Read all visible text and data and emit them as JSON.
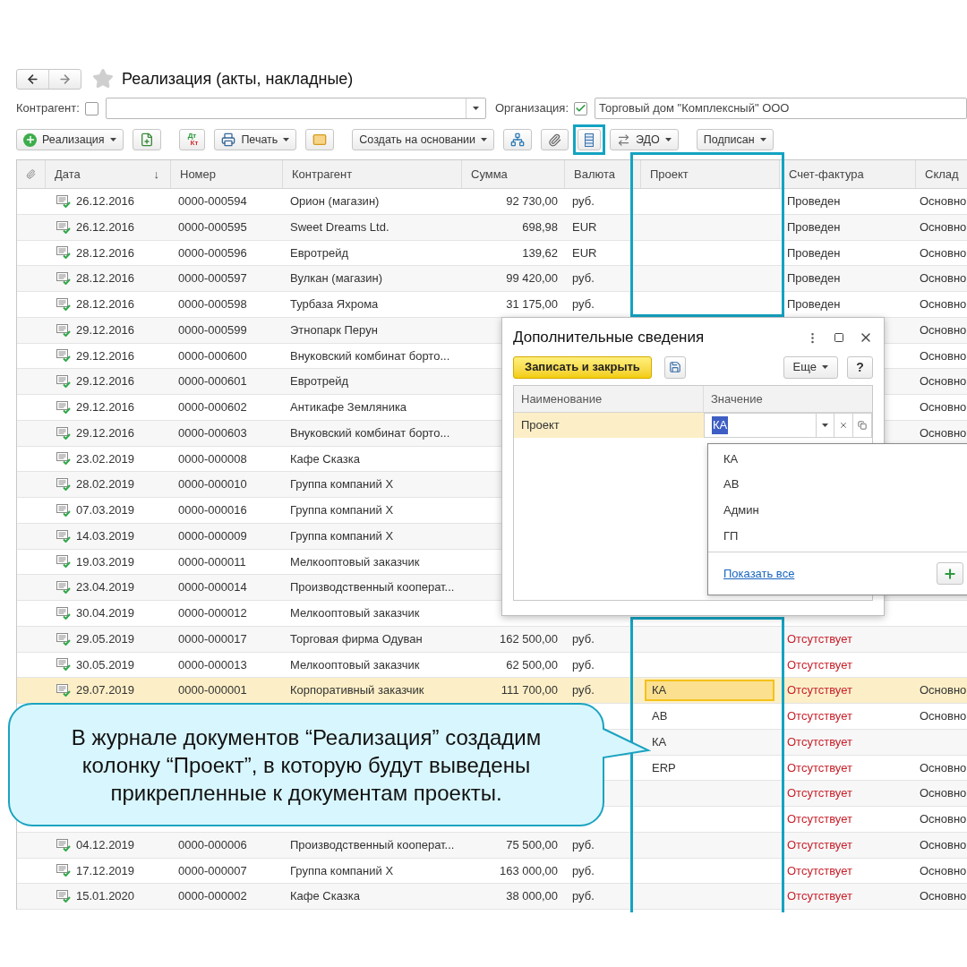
{
  "window": {
    "title": "Реализация (акты, накладные)"
  },
  "filters": [
    {
      "label": "Контрагент:",
      "checked": false,
      "kind": "combo"
    },
    {
      "label": "Организация:",
      "checked": true,
      "value": "Торговый дом \"Комплексный\" ООО",
      "kind": "text"
    }
  ],
  "toolbar": [
    [
      {
        "kind": "plus",
        "label": "Реализация",
        "dropdown": true
      },
      {
        "kind": "doc-add"
      }
    ],
    [
      {
        "kind": "dtkt",
        "icon_text": [
          "Дт",
          "Кт"
        ]
      },
      {
        "kind": "print",
        "label": "Печать",
        "dropdown": true
      },
      {
        "kind": "mail"
      }
    ],
    [
      {
        "kind": "text",
        "label": "Создать на основании",
        "dropdown": true
      },
      {
        "kind": "struct"
      },
      {
        "kind": "clip"
      },
      {
        "kind": "list",
        "highlighted": true
      },
      {
        "kind": "edo",
        "label": "ЭДО",
        "dropdown": true
      }
    ],
    [
      {
        "kind": "text",
        "label": "Подписан",
        "dropdown": true
      }
    ]
  ],
  "table": {
    "columns": [
      {
        "kind": "clip"
      },
      {
        "label": "Дата",
        "sort": "↓"
      },
      {
        "label": "Номер"
      },
      {
        "label": "Контрагент"
      },
      {
        "label": "Сумма"
      },
      {
        "label": "Валюта"
      },
      {
        "label": "Проект",
        "highlighted": true
      },
      {
        "label": "Счет-фактура"
      },
      {
        "label": "Склад"
      }
    ],
    "rows": [
      {
        "date": "26.12.2016",
        "number": "0000-000594",
        "counterparty": "Орион (магазин)",
        "sum": "92 730,00",
        "currency": "руб.",
        "invoice": "Проведен",
        "invoice_missing": false,
        "warehouse": "Основно",
        "selected": false
      },
      {
        "date": "26.12.2016",
        "number": "0000-000595",
        "counterparty": "Sweet Dreams Ltd.",
        "sum": "698,98",
        "currency": "EUR",
        "invoice": "Проведен",
        "invoice_missing": false,
        "warehouse": "Основно",
        "selected": false
      },
      {
        "date": "28.12.2016",
        "number": "0000-000596",
        "counterparty": "Евротрейд",
        "sum": "139,62",
        "currency": "EUR",
        "invoice": "Проведен",
        "invoice_missing": false,
        "warehouse": "Основно",
        "selected": false
      },
      {
        "date": "28.12.2016",
        "number": "0000-000597",
        "counterparty": "Вулкан (магазин)",
        "sum": "99 420,00",
        "currency": "руб.",
        "invoice": "Проведен",
        "invoice_missing": false,
        "warehouse": "Основно",
        "selected": false
      },
      {
        "date": "28.12.2016",
        "number": "0000-000598",
        "counterparty": "Турбаза Яхрома",
        "sum": "31 175,00",
        "currency": "руб.",
        "invoice": "Проведен",
        "invoice_missing": false,
        "warehouse": "Основно",
        "selected": false
      },
      {
        "date": "29.12.2016",
        "number": "0000-000599",
        "counterparty": "Этнопарк Перун",
        "warehouse": "Основно",
        "selected": false
      },
      {
        "date": "29.12.2016",
        "number": "0000-000600",
        "counterparty": "Внуковский комбинат борто...",
        "warehouse": "Основно",
        "selected": false
      },
      {
        "date": "29.12.2016",
        "number": "0000-000601",
        "counterparty": "Евротрейд",
        "warehouse": "Основно",
        "selected": false
      },
      {
        "date": "29.12.2016",
        "number": "0000-000602",
        "counterparty": "Антикафе Земляника",
        "warehouse": "Основно",
        "selected": false
      },
      {
        "date": "29.12.2016",
        "number": "0000-000603",
        "counterparty": "Внуковский комбинат борто...",
        "warehouse": "Основно",
        "selected": false
      },
      {
        "date": "23.02.2019",
        "number": "0000-000008",
        "counterparty": "Кафе Сказка",
        "selected": false
      },
      {
        "date": "28.02.2019",
        "number": "0000-000010",
        "counterparty": "Группа компаний X",
        "selected": false
      },
      {
        "date": "07.03.2019",
        "number": "0000-000016",
        "counterparty": "Группа компаний X",
        "selected": false
      },
      {
        "date": "14.03.2019",
        "number": "0000-000009",
        "counterparty": "Группа компаний X",
        "selected": false
      },
      {
        "date": "19.03.2019",
        "number": "0000-000011",
        "counterparty": "Мелкооптовый заказчик",
        "selected": false
      },
      {
        "date": "23.04.2019",
        "number": "0000-000014",
        "counterparty": "Производственный кооперат...",
        "selected": false
      },
      {
        "date": "30.04.2019",
        "number": "0000-000012",
        "counterparty": "Мелкооптовый заказчик",
        "selected": false
      },
      {
        "date": "29.05.2019",
        "number": "0000-000017",
        "counterparty": "Торговая фирма Одуван",
        "sum": "162 500,00",
        "currency": "руб.",
        "invoice": "Отсутствует",
        "invoice_missing": true,
        "selected": false
      },
      {
        "date": "30.05.2019",
        "number": "0000-000013",
        "counterparty": "Мелкооптовый заказчик",
        "sum": "62 500,00",
        "currency": "руб.",
        "invoice": "Отсутствует",
        "invoice_missing": true,
        "selected": false
      },
      {
        "date": "29.07.2019",
        "number": "0000-000001",
        "counterparty": "Корпоративный заказчик",
        "sum": "111 700,00",
        "currency": "руб.",
        "project": "КА",
        "invoice": "Отсутствует",
        "invoice_missing": true,
        "warehouse": "Основно",
        "selected": true
      },
      {
        "project": "АВ",
        "invoice": "Отсутствует",
        "invoice_missing": true,
        "warehouse": "Основно",
        "selected": false
      },
      {
        "project": "КА",
        "invoice": "Отсутствует",
        "invoice_missing": true,
        "selected": false
      },
      {
        "project": "ERP",
        "invoice": "Отсутствует",
        "invoice_missing": true,
        "warehouse": "Основно",
        "selected": false
      },
      {
        "invoice": "Отсутствует",
        "invoice_missing": true,
        "warehouse": "Основно",
        "selected": false
      },
      {
        "invoice": "Отсутствует",
        "invoice_missing": true,
        "warehouse": "Основно",
        "selected": false
      },
      {
        "date": "04.12.2019",
        "number": "0000-000006",
        "counterparty": "Производственный кооперат...",
        "sum": "75 500,00",
        "currency": "руб.",
        "invoice": "Отсутствует",
        "invoice_missing": true,
        "warehouse": "Основно",
        "selected": false
      },
      {
        "date": "17.12.2019",
        "number": "0000-000007",
        "counterparty": "Группа компаний X",
        "sum": "163 000,00",
        "currency": "руб.",
        "invoice": "Отсутствует",
        "invoice_missing": true,
        "warehouse": "Основно",
        "selected": false
      },
      {
        "date": "15.01.2020",
        "number": "0000-000002",
        "counterparty": "Кафе Сказка",
        "sum": "38 000,00",
        "currency": "руб.",
        "invoice": "Отсутствует",
        "invoice_missing": true,
        "warehouse": "Основно",
        "selected": false
      }
    ]
  },
  "dialog": {
    "title": "Дополнительные сведения",
    "primary_button": "Записать и закрыть",
    "more_button": "Еще",
    "help_button": "?",
    "columns": [
      "Наименование",
      "Значение"
    ],
    "rows": [
      {
        "name": "Проект",
        "value": "КА",
        "selected": true
      }
    ],
    "dropdown": {
      "items": [
        "КА",
        "АВ",
        "Админ",
        "ГП"
      ],
      "link": "Показать все"
    }
  },
  "callout": {
    "text": "В журнале документов “Реализация” создадим колонку “Проект”, в которую будут выведены прикрепленные к документам проекты."
  }
}
